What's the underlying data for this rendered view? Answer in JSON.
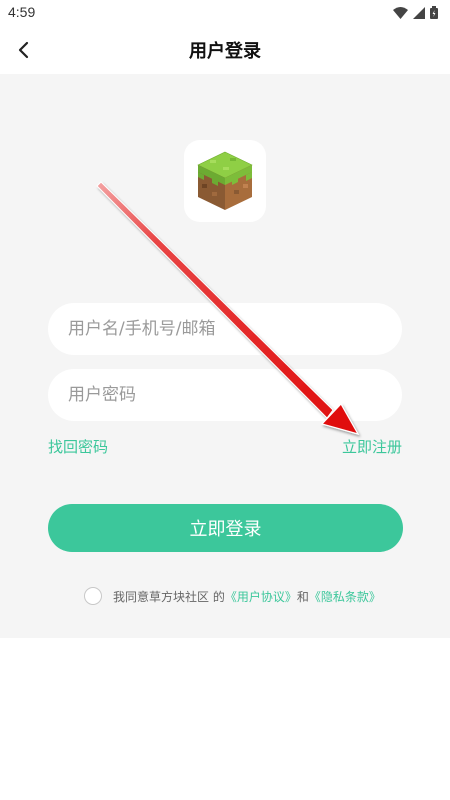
{
  "status_bar": {
    "time": "4:59",
    "icons": [
      "wifi-icon",
      "signal-icon",
      "battery-icon"
    ]
  },
  "header": {
    "title": "用户登录",
    "back_icon": "chevron-left-icon"
  },
  "logo": {
    "icon": "grass-block-icon"
  },
  "form": {
    "username_placeholder": "用户名/手机号/邮箱",
    "username_value": "",
    "password_placeholder": "用户密码",
    "password_value": "",
    "forgot_password": "找回密码",
    "register": "立即注册",
    "login_button": "立即登录"
  },
  "agreement": {
    "prefix": "我同意草方块社区 的",
    "user_agreement": "《用户协议》",
    "conjunction": "和",
    "privacy_policy": "《隐私条款》",
    "checked": false
  },
  "colors": {
    "accent": "#3cc79b",
    "panel_bg": "#f5f5f5",
    "annotation_arrow": "#e81c1c"
  }
}
